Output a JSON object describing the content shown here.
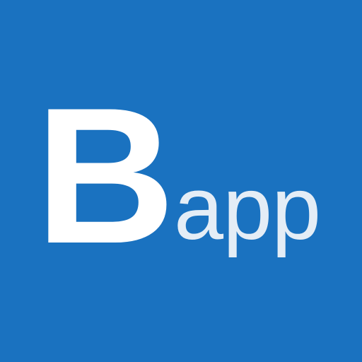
{
  "app_icon": {
    "background_color": "#1a72c0",
    "wordmark": {
      "letter": "B",
      "suffix": "app",
      "letter_color": "#ffffff",
      "suffix_color": "#e4edf6"
    }
  }
}
